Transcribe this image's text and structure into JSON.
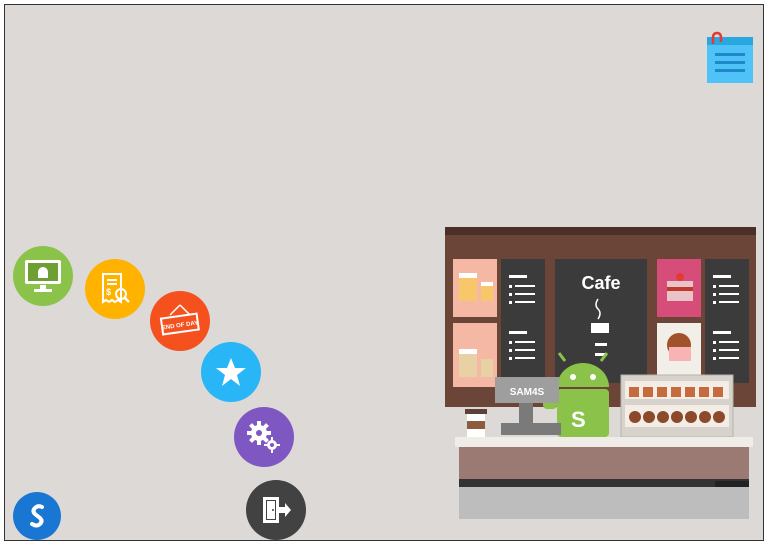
{
  "launcher": {
    "items": [
      {
        "icon": "android-monitor-icon",
        "color": "#8bc34a"
      },
      {
        "icon": "receipt-search-icon",
        "color": "#ffb300"
      },
      {
        "icon": "end-of-day-sign-icon",
        "color": "#f4511e",
        "sign_text": "END OF DAY"
      },
      {
        "icon": "star-icon",
        "color": "#29b6f6"
      },
      {
        "icon": "gears-icon",
        "color": "#7e57c2"
      },
      {
        "icon": "exit-door-icon",
        "color": "#424242"
      }
    ],
    "logo": {
      "icon": "s-logo-icon",
      "color": "#1976d2"
    }
  },
  "notes": {
    "icon": "sticky-note-icon",
    "color": "#4fc3f7"
  },
  "illustration": {
    "sign_text": "Cafe",
    "register_brand": "SAM4S",
    "register_mark": "S"
  }
}
